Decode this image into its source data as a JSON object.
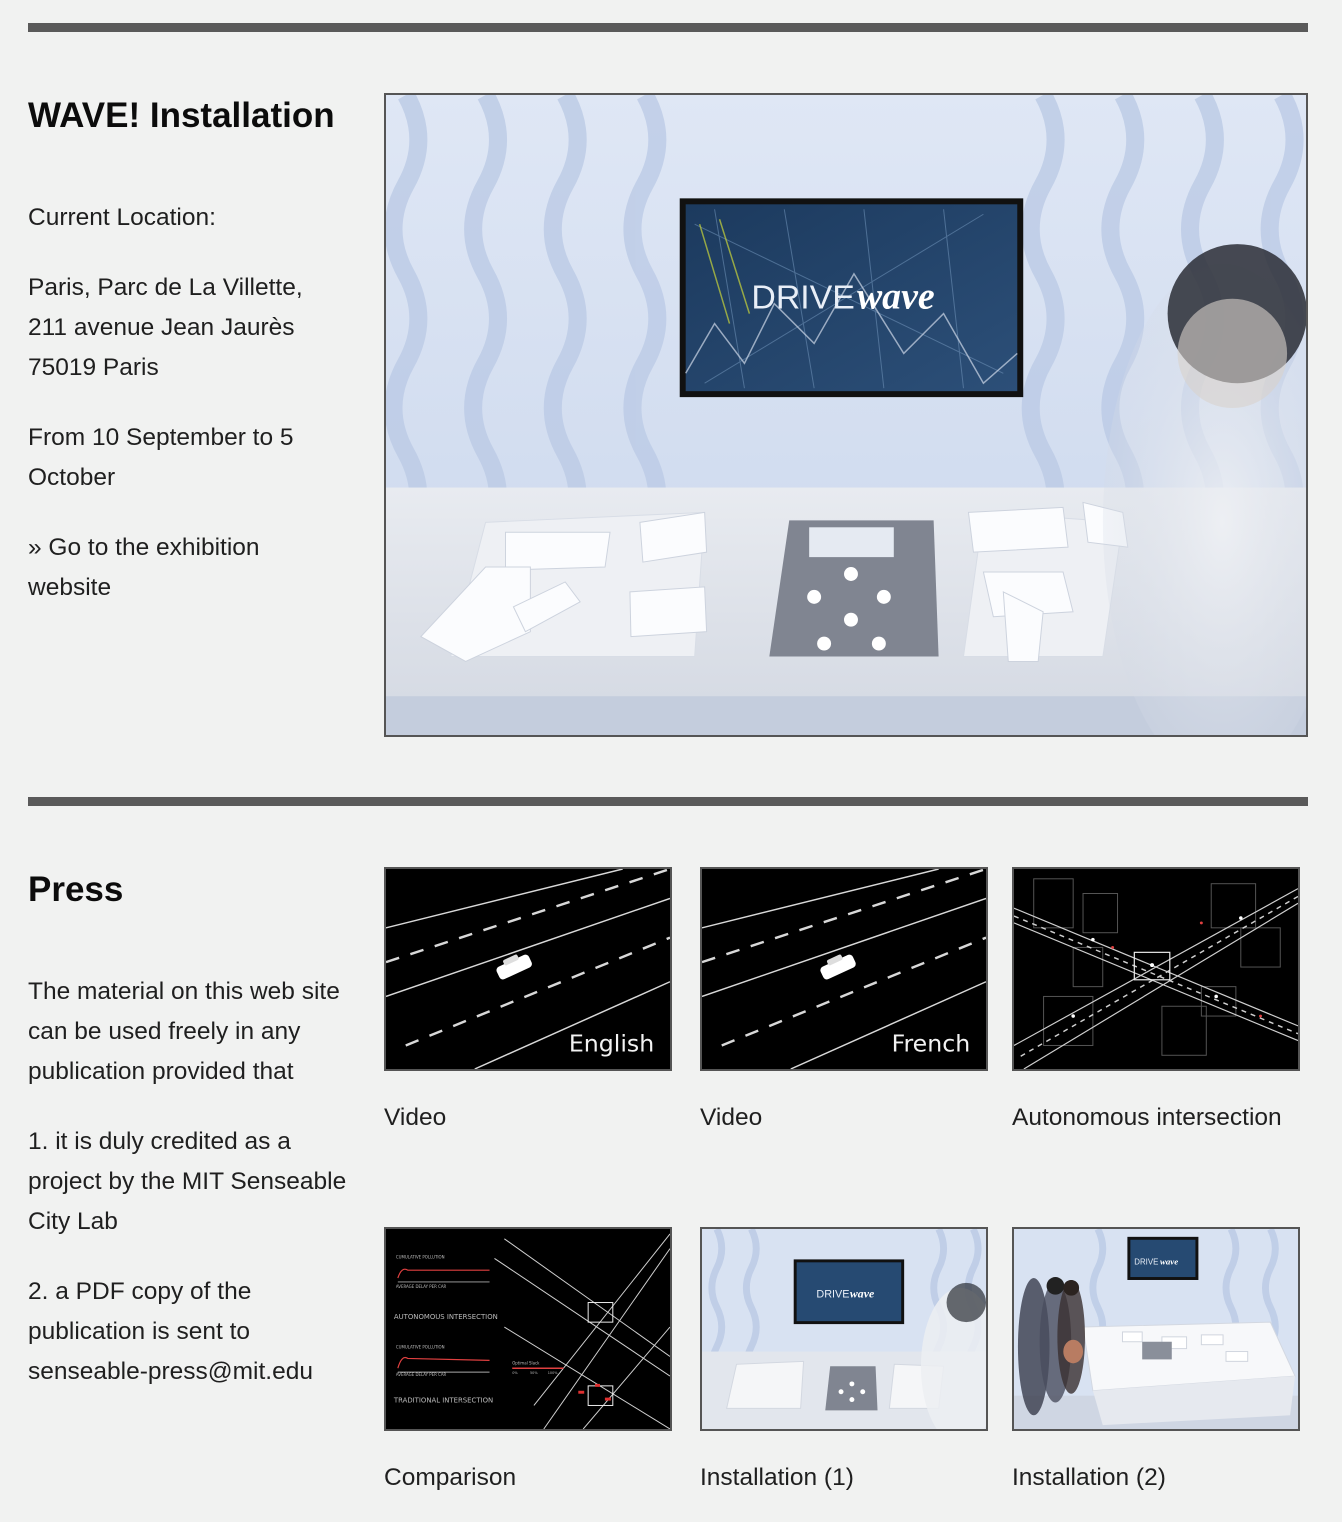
{
  "installation": {
    "title": "WAVE! Installation",
    "location_label": "Current Location:",
    "address_lines": [
      "Paris, Parc de La Villette,",
      "211 avenue Jean Jaurès",
      "75019 Paris"
    ],
    "dates": "From 10 September to 5 October",
    "link_text": "» Go to the exhibition website",
    "image": {
      "brand_left": "DRIVE",
      "brand_right": "wave"
    }
  },
  "press": {
    "title": "Press",
    "intro": "The material on this web site can be used freely in any publication provided that",
    "condition_1": "1. it is duly credited as a project by the MIT Senseable City Lab",
    "condition_2": "2. a PDF copy of the publication is sent to senseable-press@mit.edu",
    "items": [
      {
        "caption": "Video",
        "overlay": "English"
      },
      {
        "caption": "Video",
        "overlay": "French"
      },
      {
        "caption": "Autonomous intersection"
      },
      {
        "caption": "Comparison",
        "overlay_labels": [
          "CUMULATIVE POLLUTION",
          "AVERAGE DELAY PER CAR",
          "AUTONOMOUS INTERSECTION",
          "CUMULATIVE POLLUTION",
          "AVERAGE DELAY PER CAR",
          "Optimal Slack",
          "0%",
          "50%",
          "100%",
          "TRADITIONAL INTERSECTION"
        ]
      },
      {
        "caption": "Installation (1)",
        "brand_left": "DRIVE",
        "brand_right": "wave"
      },
      {
        "caption": "Installation (2)",
        "brand_left": "DRIVE",
        "brand_right": "wave"
      }
    ]
  },
  "colors": {
    "rule": "#5a5a5a",
    "background": "#f1f2f1",
    "frame_border": "#555555",
    "thumb_bg": "#000000"
  }
}
